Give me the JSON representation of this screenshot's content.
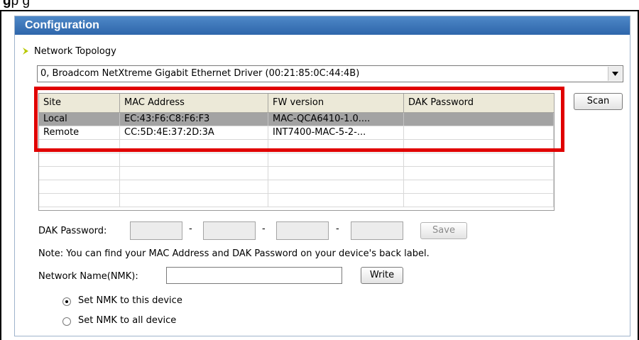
{
  "caption": {
    "prefix": "g",
    "text": "p              g"
  },
  "panel": {
    "title": "Configuration"
  },
  "topology": {
    "label": "Network Topology",
    "selected_adapter": "0,  Broadcom NetXtreme Gigabit Ethernet Driver  (00:21:85:0C:44:4B)"
  },
  "scan_label": "Scan",
  "table": {
    "columns": [
      "Site",
      "MAC Address",
      "FW version",
      "DAK Password"
    ],
    "rows": [
      {
        "site": "Local",
        "mac": "EC:43:F6:C8:F6:F3",
        "fw": "MAC-QCA6410-1.0....",
        "dak": ""
      },
      {
        "site": "Remote",
        "mac": "CC:5D:4E:37:2D:3A",
        "fw": "INT7400-MAC-5-2-...",
        "dak": ""
      }
    ]
  },
  "dak": {
    "label": "DAK Password:",
    "separator": "-",
    "save_label": "Save",
    "note": "Note: You can find your MAC Address and DAK Password on your device's back label."
  },
  "nmk": {
    "label": "Network Name(NMK):",
    "value": "",
    "write_label": "Write",
    "options": [
      {
        "label": "Set NMK to this device",
        "selected": true
      },
      {
        "label": "Set NMK to all device",
        "selected": false
      }
    ]
  },
  "colors": {
    "header_blue": "#3a76ba",
    "highlight_red": "#e00000",
    "selected_row": "#a3a3a3",
    "arrow_green": "#b8c800"
  }
}
